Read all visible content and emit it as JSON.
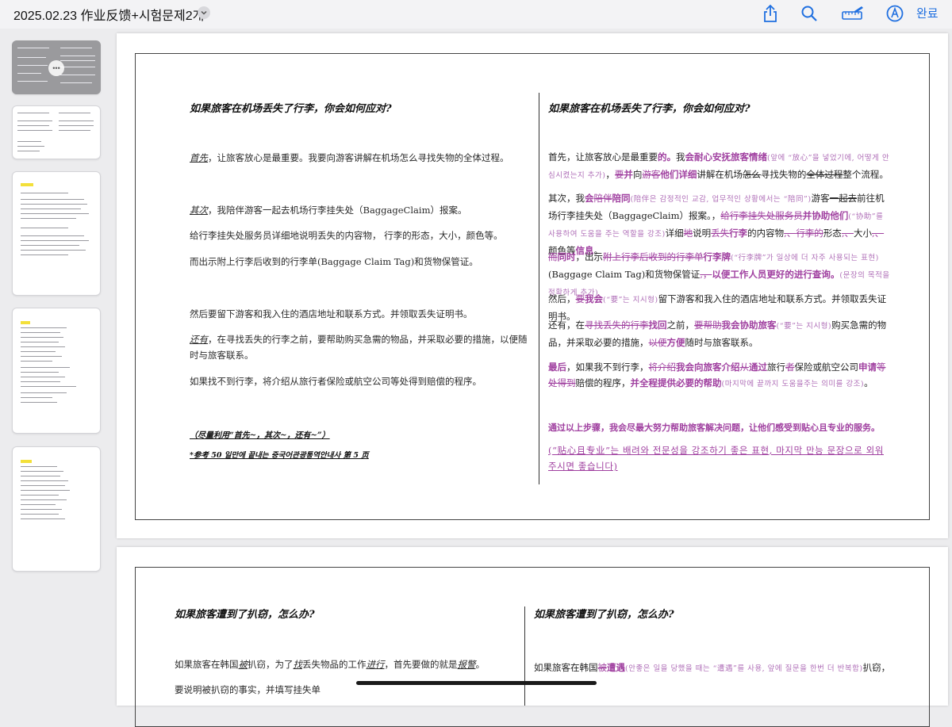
{
  "topbar": {
    "title": "2025.02.23 作业反馈+시험문제2개",
    "share_icon": "share-icon",
    "search_icon": "search-icon",
    "markup_icon": "pencil-ruler-icon",
    "pen_icon": "pen-circle-icon",
    "done_label": "완료"
  },
  "sidebar": {
    "thumbnails": [
      "page-1",
      "page-2",
      "page-3",
      "page-4",
      "page-5"
    ],
    "selected_options": "•••"
  },
  "page1": {
    "left": {
      "question": "如果旅客在机场丢失了行李，你会如何应对?",
      "p1_em": "首先",
      "p1_rest": "，让旅客放心是最重要。我要向游客讲解在机场怎么寻找失物的全体过程。",
      "p2_em": "其次",
      "p2_rest": "，我陪伴游客一起去机场行李挂失处（BaggageClaim）报案。",
      "p3": "给行李挂失处服务员详细地说明丢失的内容物，  行李的形态，大小，颜色等。",
      "p4": "而出示附上行李后收到的行李单(Baggage Claim Tag)和货物保管证。",
      "p5": "然后要留下游客和我入住的酒店地址和联系方式。并领取丢失证明书。",
      "p6_em": "还有",
      "p6_rest": "，在寻找丢失的行李之前，要帮助购买急需的物品，并采取必要的措施，以便随时与旅客联系。",
      "p7": "如果找不到行李，将介绍从旅行者保险或航空公司等处得到赔偿的程序。",
      "note1": "（尽量利用“首先~，其次~，还有~”）",
      "note2": "*参考 50 일만에 끝내는 중국어관광통역안내사 第 5 页"
    },
    "right": {
      "question": "如果旅客在机场丢失了行李，你会如何应对?",
      "s1": [
        "首先，让旅客放心是最重要",
        "的。",
        "我",
        "会耐心安抚旅客情绪",
        "(앞에 “放心”을 넣었기에, 어떻게 안심시켰는지 추가)",
        "，",
        "要",
        "并",
        "向",
        "游客",
        "他们详细",
        "讲解在机场",
        "怎么",
        "寻找失物的",
        "全体过程",
        "整个流程。"
      ],
      "s2": [
        "其次，我",
        "会",
        "陪伴",
        "陪同",
        "(陪伴은 감정적인 교감, 업무적인 상황에서는 “陪同”)",
        "游客",
        "一起去",
        "前往机场行李挂失处（BaggageClaim）报案。，",
        "给行李挂失处服务员",
        "并协助他们",
        "(“协助”를 사용하여 도움을 주는 역할을 강조)",
        "详细",
        "地",
        "说明",
        "丢失",
        "行李",
        "的内容物",
        ",、",
        "行李的",
        "形态",
        ",、",
        "大小",
        ",、",
        "颜色等",
        "信息",
        "。"
      ],
      "s3": [
        "而",
        "同时",
        "，出示",
        "附上行李后收到的行李单",
        "行李牌",
        "(“行李牌”가 일상에 더 자주 사용되는 표현)",
        "(Baggage Claim Tag)和货物保管证",
        ",，",
        "以便工作人员更好的进行查询。",
        "(문장의 목적을 정확하게 추가)"
      ],
      "s4": [
        "然后，",
        "要",
        "我会",
        "(“要”는 지시형)",
        "留下游客和我入住的酒店地址和联系方式。并领取丢失证明书。"
      ],
      "s5": [
        "还有，在",
        "寻找丢失的行李",
        "找回",
        "之前，",
        "要帮助",
        "我会协助旅客",
        "(“要”는 지시형)",
        "购买急需的物品，并采取必要的措施，",
        "以便",
        "方便",
        "随时与旅客联系。"
      ],
      "s6": [
        "最后",
        "，如果我不到行李，",
        "将介绍",
        "我会向旅客介绍",
        "从",
        "通过",
        "旅行",
        "者",
        "保险或航空公司",
        "申请",
        "等处得到",
        "赔偿的程序，",
        "并全程提供必要的帮助",
        "(마지막에 끝까지 도움을주는 의미를 강조)",
        "。"
      ],
      "summary": "通过以上步骤，我会尽最大努力帮助旅客解决问题，让他们感受到贴心且专业的服务。",
      "summary_note": "(“贴心且专业”는 배려와 전문성을 강조하기 좋은 표현, 마지막 만능 문장으로 외워주시면 좋습니다)"
    }
  },
  "page2": {
    "left": {
      "question": "如果旅客遭到了扒窃，怎么办?",
      "p1_a": "如果旅客在韩国",
      "p1_b": "被",
      "p1_c": "扒窃，为了",
      "p1_d": "找",
      "p1_e": "丢失物品的工作",
      "p1_f": "进行",
      "p1_g": "，首先要做的就是",
      "p1_h": "报警",
      "p1_i": "。",
      "p2": "要说明被扒窃的事实，并填写挂失单"
    },
    "right": {
      "question": "如果旅客遭到了扒窃，怎么办?",
      "p1_a": "如果旅客在韩国",
      "p1_b": "被",
      "p1_c": "遭遇",
      "p1_d": "(안좋은 일을 당했을 때는 “遭遇”를 사용, 앞에 질문을 한번 더 반복함)",
      "p1_e": "扒窃，"
    }
  },
  "colors": {
    "accent": "#1f6fe0",
    "correction": "#a040a0",
    "highlight": "#f3e03a"
  }
}
